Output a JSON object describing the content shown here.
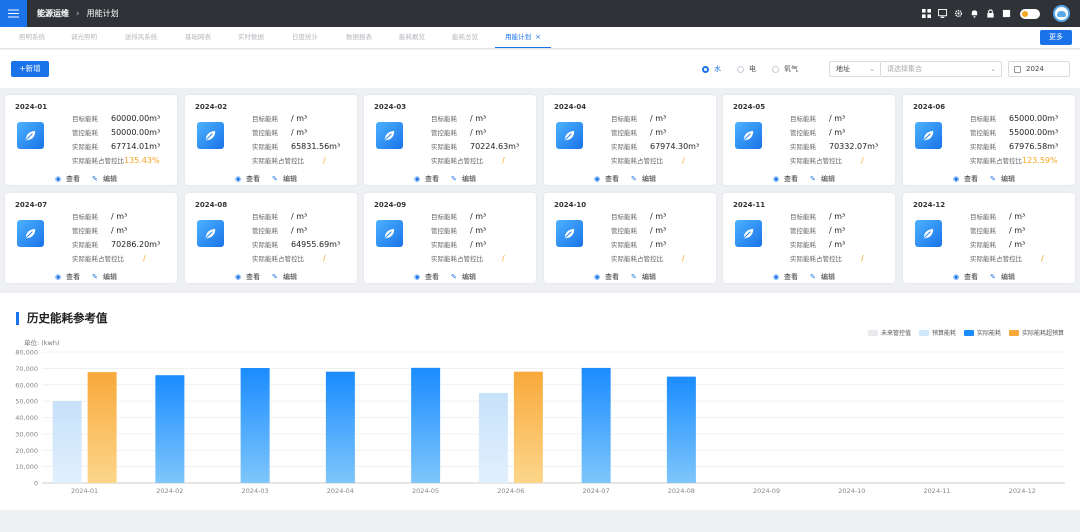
{
  "header": {
    "crumb_root": "能源运维",
    "crumb_current": "用能计划",
    "icons": [
      "grid-icon",
      "monitor-icon",
      "gear-icon",
      "bell-icon",
      "lock-icon",
      "fullscreen-icon"
    ]
  },
  "tabs": [
    {
      "label": "照明系统",
      "active": false
    },
    {
      "label": "调光照明",
      "active": false
    },
    {
      "label": "送排风系统",
      "active": false
    },
    {
      "label": "基础网表",
      "active": false
    },
    {
      "label": "实时数据",
      "active": false
    },
    {
      "label": "日度统计",
      "active": false
    },
    {
      "label": "数据报表",
      "active": false
    },
    {
      "label": "能耗概览",
      "active": false
    },
    {
      "label": "能耗总览",
      "active": false
    },
    {
      "label": "用能计划",
      "active": true
    }
  ],
  "more_label": "更多",
  "toolbar": {
    "add_label": "+新增",
    "radios": [
      {
        "label": "水",
        "checked": true
      },
      {
        "label": "电",
        "checked": false
      },
      {
        "label": "氧气",
        "checked": false
      }
    ],
    "address_label": "地址",
    "set_placeholder": "请选择集合",
    "year": "2024"
  },
  "labels": {
    "target": "目标能耗",
    "control": "管控能耗",
    "actual": "实际能耗",
    "ratio": "实际能耗占管控比",
    "view": "查看",
    "edit": "编辑"
  },
  "cards": [
    {
      "month": "2024-01",
      "target": "60000.00m³",
      "control": "50000.00m³",
      "actual": "67714.01m³",
      "ratio": "135.43%"
    },
    {
      "month": "2024-02",
      "target": "/ m³",
      "control": "/ m³",
      "actual": "65831.56m³",
      "ratio": "/"
    },
    {
      "month": "2024-03",
      "target": "/ m³",
      "control": "/ m³",
      "actual": "70224.63m³",
      "ratio": "/"
    },
    {
      "month": "2024-04",
      "target": "/ m³",
      "control": "/ m³",
      "actual": "67974.30m³",
      "ratio": "/"
    },
    {
      "month": "2024-05",
      "target": "/ m³",
      "control": "/ m³",
      "actual": "70332.07m³",
      "ratio": "/"
    },
    {
      "month": "2024-06",
      "target": "65000.00m³",
      "control": "55000.00m³",
      "actual": "67976.58m³",
      "ratio": "123.59%"
    },
    {
      "month": "2024-07",
      "target": "/ m³",
      "control": "/ m³",
      "actual": "70286.20m³",
      "ratio": "/"
    },
    {
      "month": "2024-08",
      "target": "/ m³",
      "control": "/ m³",
      "actual": "64955.69m³",
      "ratio": "/"
    },
    {
      "month": "2024-09",
      "target": "/ m³",
      "control": "/ m³",
      "actual": "/ m³",
      "ratio": "/"
    },
    {
      "month": "2024-10",
      "target": "/ m³",
      "control": "/ m³",
      "actual": "/ m³",
      "ratio": "/"
    },
    {
      "month": "2024-11",
      "target": "/ m³",
      "control": "/ m³",
      "actual": "/ m³",
      "ratio": "/"
    },
    {
      "month": "2024-12",
      "target": "/ m³",
      "control": "/ m³",
      "actual": "/ m³",
      "ratio": "/"
    }
  ],
  "chart_title": "历史能耗参考值",
  "chart_data": {
    "type": "bar",
    "title": "历史能耗参考值",
    "ylabel": "单位: (kwh)",
    "xlabel": "",
    "ylim": [
      0,
      80000
    ],
    "yticks": [
      "0",
      "10,000",
      "20,000",
      "30,000",
      "40,000",
      "50,000",
      "60,000",
      "70,000",
      "80,000"
    ],
    "grid": true,
    "legend_position": "top-right",
    "categories": [
      "2024-01",
      "2024-02",
      "2024-03",
      "2024-04",
      "2024-05",
      "2024-06",
      "2024-07",
      "2024-08",
      "2024-09",
      "2024-10",
      "2024-11",
      "2024-12"
    ],
    "series": [
      {
        "name": "未来管控值",
        "color": "#e8eaed",
        "values": [
          null,
          null,
          null,
          null,
          null,
          null,
          null,
          null,
          null,
          null,
          null,
          null
        ]
      },
      {
        "name": "预算能耗",
        "color": "#cfe6fb",
        "values": [
          50000,
          null,
          null,
          null,
          null,
          55000,
          null,
          null,
          null,
          null,
          null,
          null
        ]
      },
      {
        "name": "实际能耗",
        "color": "#1a8cff",
        "values": [
          null,
          65831.56,
          70224.63,
          67974.3,
          70332.07,
          null,
          70286.2,
          64955.69,
          null,
          null,
          null,
          null
        ]
      },
      {
        "name": "实际能耗超预算",
        "color": "#f8a93a",
        "values": [
          67714.01,
          null,
          null,
          null,
          null,
          67976.58,
          null,
          null,
          null,
          null,
          null,
          null
        ]
      }
    ]
  }
}
